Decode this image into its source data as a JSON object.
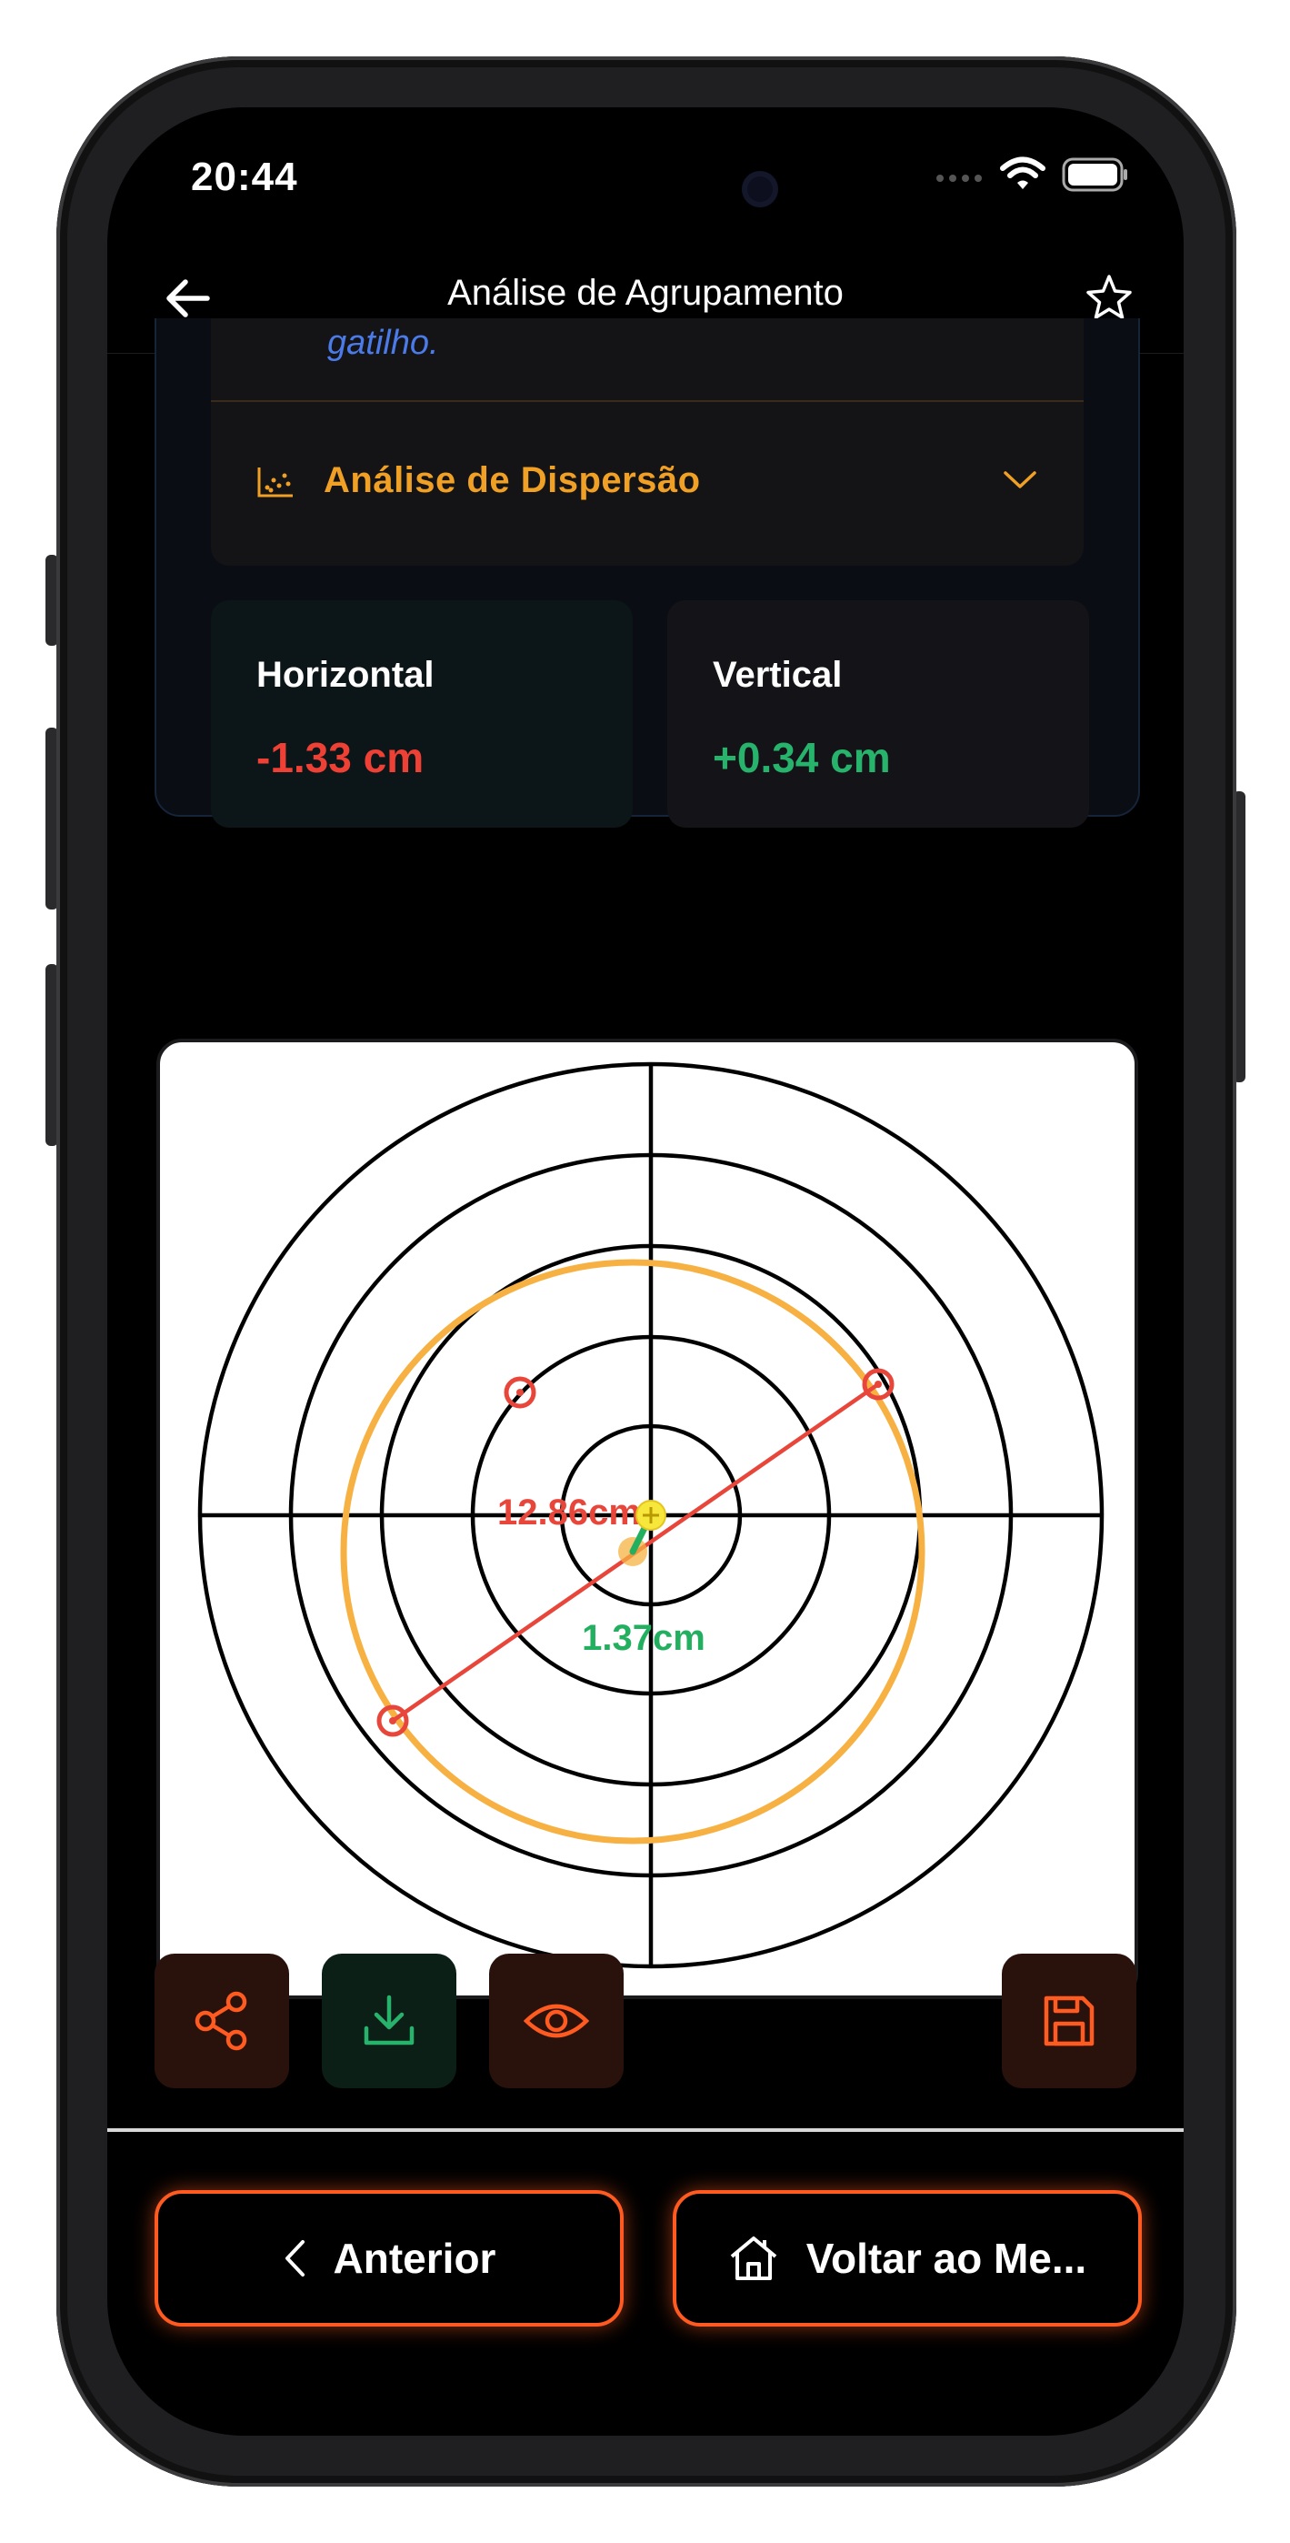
{
  "status_bar": {
    "time": "20:44"
  },
  "nav": {
    "title": "Análise de Agrupamento",
    "back_icon": "arrow-left-icon",
    "favorite_icon": "star-icon"
  },
  "tip_card": {
    "text": "gatilho."
  },
  "dispersion_section": {
    "label": "Análise de Dispersão",
    "icon": "scatter-chart-icon",
    "expanded": false
  },
  "stats": {
    "horizontal": {
      "title": "Horizontal",
      "value": "-1.33 cm",
      "color": "#ee4035"
    },
    "vertical": {
      "title": "Vertical",
      "value": "+0.34 cm",
      "color": "#27b36b"
    }
  },
  "target": {
    "group_size_label": "12.86cm",
    "offset_label": "1.37cm",
    "colors": {
      "group_line": "#e8463a",
      "group_circle": "#f6b142",
      "offset_line": "#22b060",
      "center_marker": "#f7e63c"
    }
  },
  "actions": {
    "share_icon": "share-icon",
    "download_icon": "download-icon",
    "view_icon": "eye-icon",
    "save_icon": "floppy-disk-icon",
    "accent": "#ff5a1f",
    "download_color": "#27b36b"
  },
  "footer": {
    "prev_label": "Anterior",
    "home_label": "Voltar ao Me..."
  }
}
